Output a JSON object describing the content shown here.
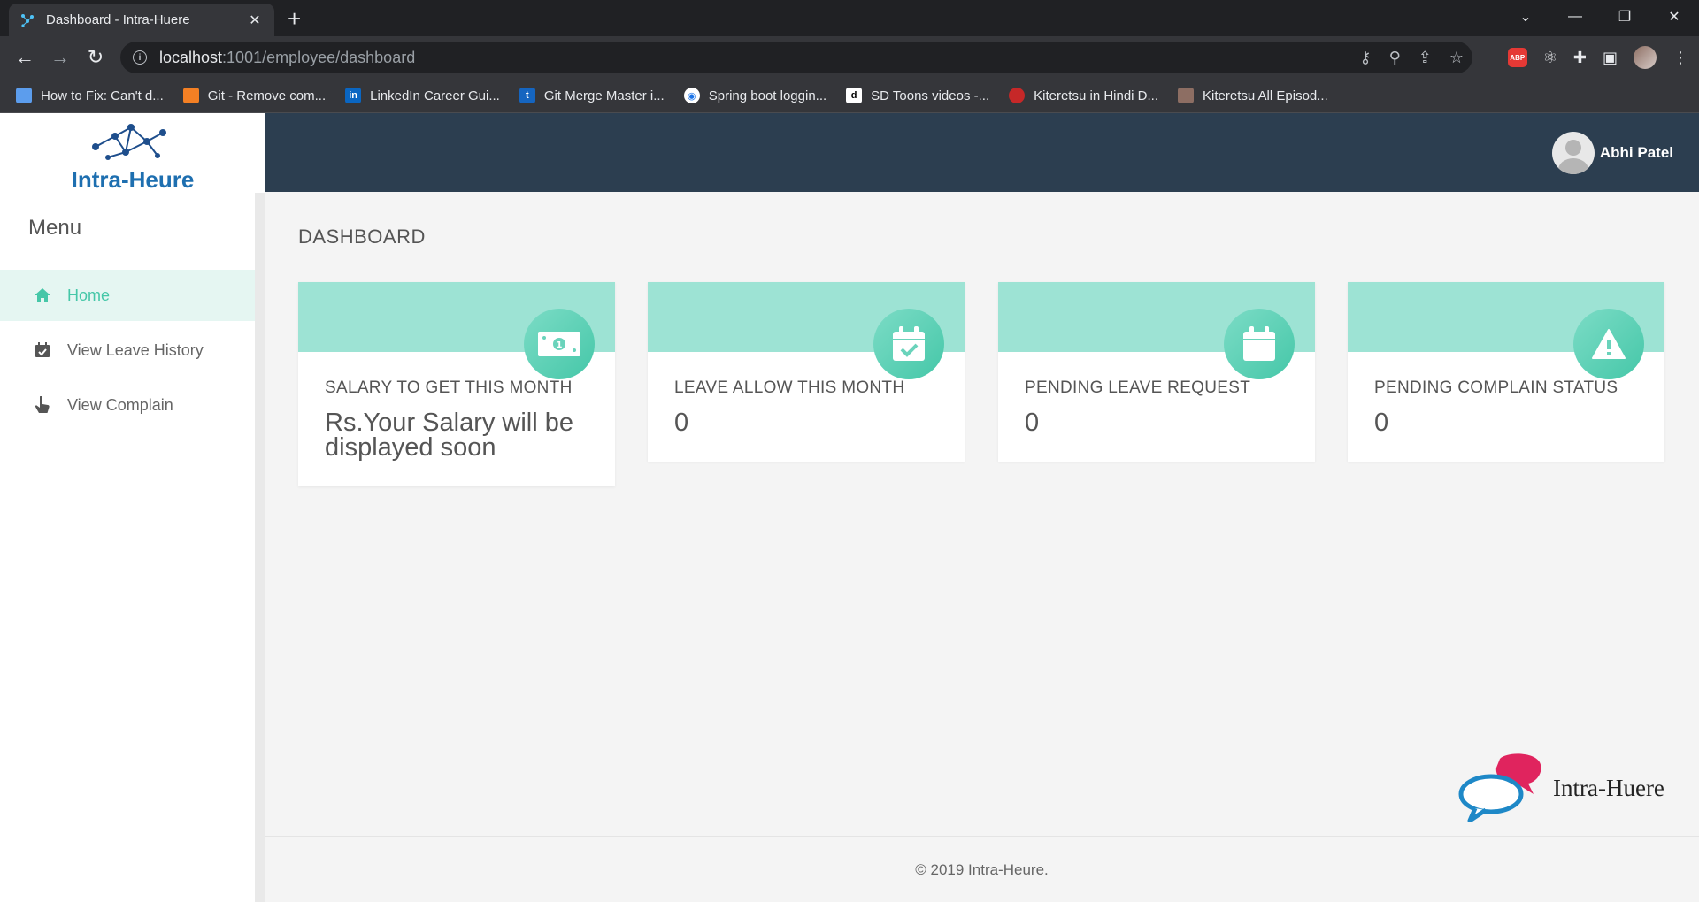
{
  "browser": {
    "tab_title": "Dashboard - Intra-Huere",
    "tab_close": "✕",
    "new_tab": "+",
    "url_host": "localhost",
    "url_path": ":1001/employee/dashboard",
    "bookmarks": [
      {
        "label": "How to Fix: Can't d...",
        "icon": "page-icon",
        "color": "#4a90d9"
      },
      {
        "label": "Git - Remove com...",
        "icon": "stackoverflow-icon",
        "color": "#f48024"
      },
      {
        "label": "LinkedIn Career Gui...",
        "icon": "linkedin-icon",
        "color": "#0a66c2"
      },
      {
        "label": "Git Merge Master i...",
        "icon": "tutorial-icon",
        "color": "#1565c0"
      },
      {
        "label": "Spring boot loggin...",
        "icon": "chrome-page-icon",
        "color": "#ffffff"
      },
      {
        "label": "SD Toons videos -...",
        "icon": "dailymotion-icon",
        "color": "#ffffff"
      },
      {
        "label": "Kiteretsu in Hindi D...",
        "icon": "cartoon-icon",
        "color": "#c62828"
      },
      {
        "label": "Kiteretsu All Episod...",
        "icon": "cartoon-grid-icon",
        "color": "#8d6e63"
      }
    ]
  },
  "app": {
    "logo_text": "Intra-Heure",
    "menu_title": "Menu",
    "menu": [
      {
        "label": "Home",
        "icon": "home-icon",
        "active": true
      },
      {
        "label": "View Leave History",
        "icon": "calendar-check-icon",
        "active": false
      },
      {
        "label": "View Complain",
        "icon": "hand-pointer-icon",
        "active": false
      }
    ],
    "user_name": "Abhi Patel",
    "page_title": "DASHBOARD",
    "cards": [
      {
        "label": "SALARY TO GET THIS MONTH",
        "value": "Rs.Your Salary will be displayed soon",
        "icon": "money-bill-icon"
      },
      {
        "label": "LEAVE ALLOW THIS MONTH",
        "value": "0",
        "icon": "calendar-check-icon"
      },
      {
        "label": "PENDING LEAVE REQUEST",
        "value": "0",
        "icon": "calendar-icon"
      },
      {
        "label": "PENDING COMPLAIN STATUS",
        "value": "0",
        "icon": "warning-icon"
      }
    ],
    "watermark_text": "Intra-Huere",
    "footer": "© 2019 Intra-Heure.",
    "colors": {
      "accent": "#45c7a8",
      "card_head": "#9de3d4",
      "topbar": "#2c3e50",
      "active_menu_bg": "#e5f6f2"
    }
  }
}
